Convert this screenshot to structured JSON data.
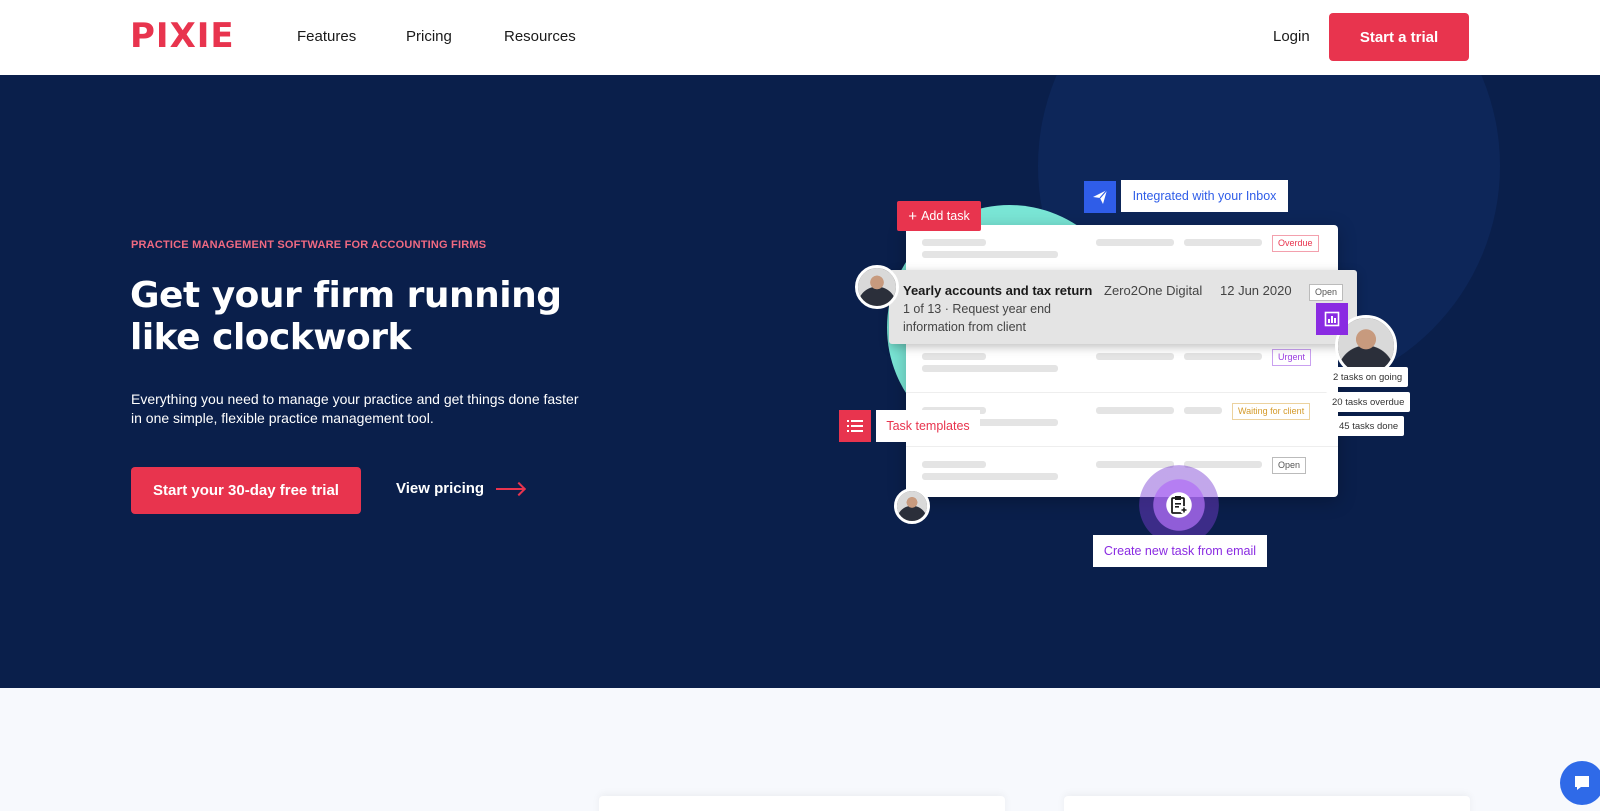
{
  "brand": {
    "logo_text": "PIXIE",
    "accent": "#e8344e",
    "hero_bg": "#0a1f4b"
  },
  "nav": {
    "links": [
      "Features",
      "Pricing",
      "Resources"
    ],
    "login": "Login",
    "cta": "Start a trial"
  },
  "hero": {
    "eyebrow": "PRACTICE MANAGEMENT SOFTWARE FOR ACCOUNTING FIRMS",
    "headline": "Get your firm running like clockwork",
    "subtext": "Everything you need to manage your practice and get things done faster in one simple, flexible practice management tool.",
    "cta": "Start your 30-day free trial",
    "secondary": "View pricing"
  },
  "illustration": {
    "add_task": "Add task",
    "inbox_label": "Integrated with your Inbox",
    "task_templates": "Task templates",
    "create_from_email": "Create new task from email",
    "statuses": {
      "overdue": "Overdue",
      "urgent": "Urgent",
      "waiting": "Waiting for client",
      "open": "Open"
    },
    "focus_task": {
      "title": "Yearly accounts and tax return",
      "subtitle": "1 of 13 · Request year end information from client",
      "client": "Zero2One Digital",
      "date": "12 Jun 2020",
      "status": "Open"
    },
    "stats": [
      "2 tasks on going",
      "20 tasks overdue",
      "45 tasks done"
    ]
  },
  "icons": {
    "send": "paper-plane-icon",
    "chart": "bar-chart-icon",
    "list": "list-icon",
    "clipboard": "clipboard-add-icon",
    "chat": "chat-icon"
  }
}
